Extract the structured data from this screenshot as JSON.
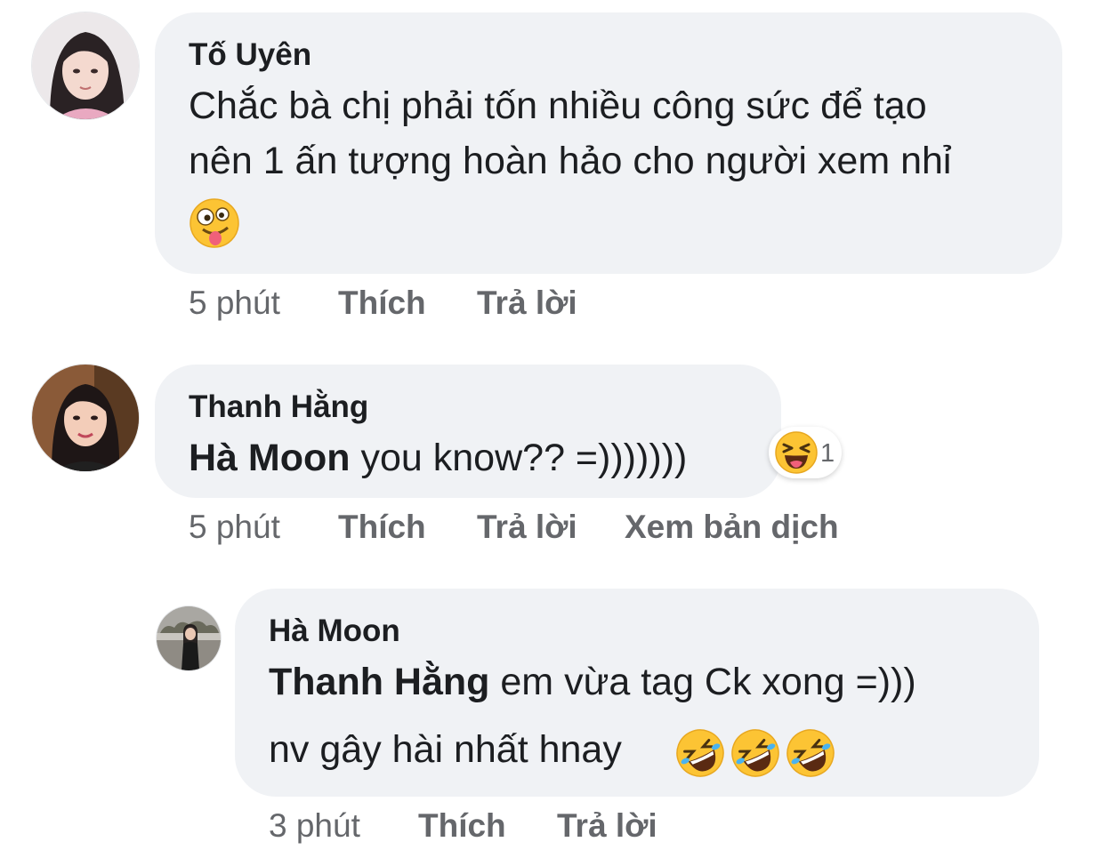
{
  "colors": {
    "bubble_bg": "#f0f2f5",
    "text": "#1c1e21",
    "meta": "#65676b"
  },
  "comments": [
    {
      "author": "Tố Uyên",
      "lines": [
        "Chắc bà chị phải tốn nhiều công sức để tạo",
        "nên 1 ấn tượng hoàn hảo cho người xem nhỉ"
      ],
      "emojis": [
        "zany-face"
      ],
      "time": "5 phút",
      "like_label": "Thích",
      "reply_label": "Trả lời"
    },
    {
      "author": "Thanh Hằng",
      "mention": "Hà Moon",
      "text": " you know?? =)))))))",
      "reaction": {
        "icon": "laughing-face",
        "count": "1"
      },
      "time": "5 phút",
      "like_label": "Thích",
      "reply_label": "Trả lời",
      "translate_label": "Xem bản dịch"
    },
    {
      "author": "Hà Moon",
      "mention": "Thanh Hằng",
      "line1_text": "  em vừa tag Ck xong =)))",
      "line2_text": "nv gây hài nhất hnay ",
      "emojis": [
        "rofl-face",
        "rofl-face",
        "rofl-face"
      ],
      "time": "3 phút",
      "like_label": "Thích",
      "reply_label": "Trả lời"
    }
  ]
}
